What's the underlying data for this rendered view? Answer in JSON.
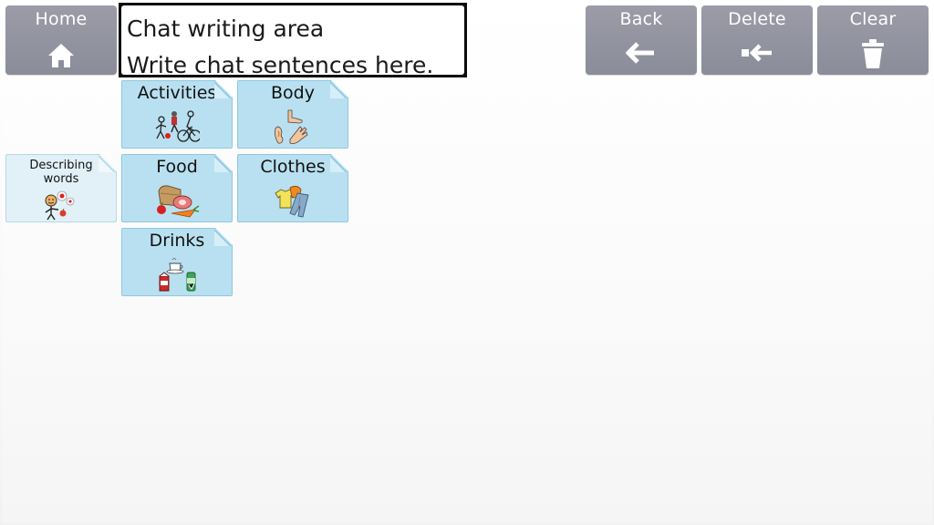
{
  "toolbar": {
    "home_label": "Home",
    "back_label": "Back",
    "delete_label": "Delete",
    "clear_label": "Clear"
  },
  "chat": {
    "line1": "Chat writing area",
    "line2": "Write chat sentences here."
  },
  "categories": {
    "activities": "Activities",
    "body": "Body",
    "describing_line1": "Describing",
    "describing_line2": "words",
    "food": "Food",
    "clothes": "Clothes",
    "drinks": "Drinks"
  },
  "colors": {
    "toolbar_button": "#9b9ca8",
    "category_card": "#b9e0f0",
    "category_card_light": "#e2f1f8"
  },
  "icons": {
    "home": "home-icon",
    "back": "arrow-left-icon",
    "delete": "backspace-icon",
    "clear": "trash-icon"
  }
}
